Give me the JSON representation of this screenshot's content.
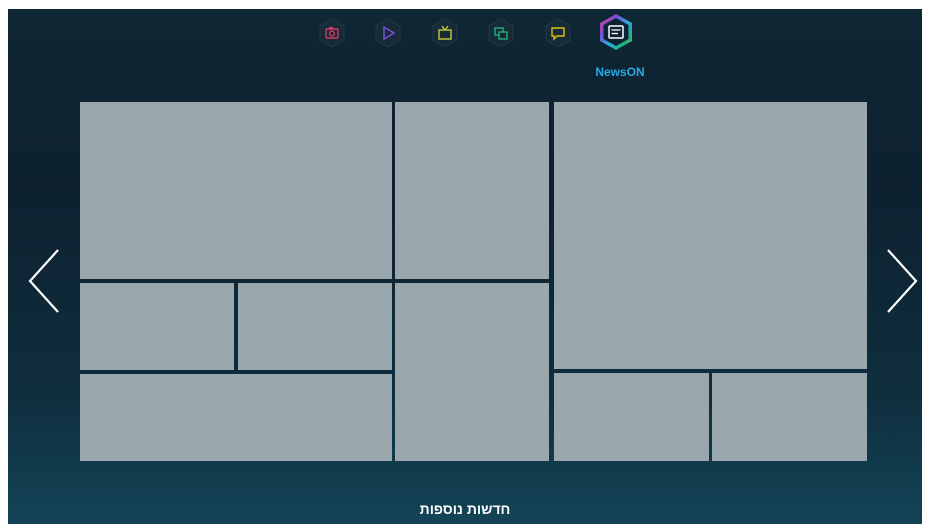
{
  "apps": [
    {
      "name": "camera",
      "icon": "camera-icon",
      "color": "#d23b63"
    },
    {
      "name": "play",
      "icon": "play-icon",
      "color": "#7a4fd6"
    },
    {
      "name": "tv",
      "icon": "tv-icon",
      "color": "#2aa0d8"
    },
    {
      "name": "multi-screen",
      "icon": "multi-screen-icon",
      "color": "#22b07a"
    },
    {
      "name": "chat",
      "icon": "chat-icon",
      "color": "#d9c11a"
    },
    {
      "name": "newson",
      "icon": "news-icon",
      "color": "#2aa9e0"
    }
  ],
  "active_app_label": "NewsON",
  "nav": {
    "prev": "chevron-left-icon",
    "next": "chevron-right-icon"
  },
  "footer": {
    "more_news": "חדשות נוספות"
  },
  "colors": {
    "tile": "#9aa7ad",
    "accent": "#2aa9e0"
  }
}
